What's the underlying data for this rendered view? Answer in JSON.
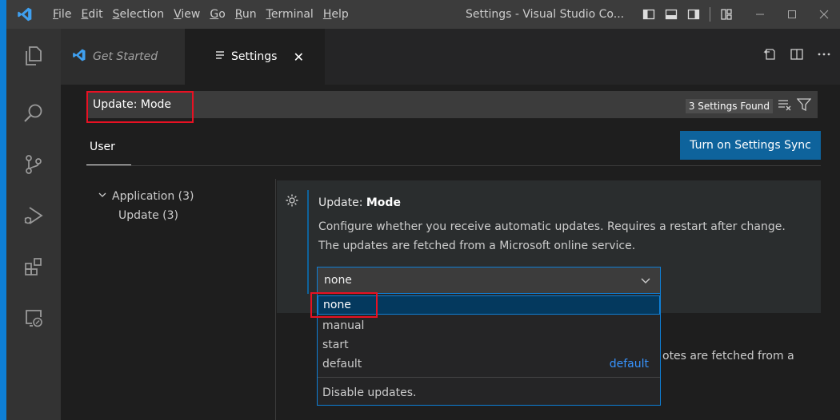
{
  "colors": {
    "accent": "#0e639c",
    "highlight": "#e81123",
    "focus": "#0e7fd6",
    "link": "#3794ff"
  },
  "titlebar": {
    "menu": [
      {
        "u": "F",
        "rest": "ile"
      },
      {
        "u": "E",
        "rest": "dit"
      },
      {
        "u": "S",
        "rest": "election"
      },
      {
        "u": "V",
        "rest": "iew"
      },
      {
        "u": "G",
        "rest": "o"
      },
      {
        "u": "R",
        "rest": "un"
      },
      {
        "u": "T",
        "rest": "erminal"
      },
      {
        "u": "H",
        "rest": "elp"
      }
    ],
    "window_title": "Settings - Visual Studio Co..."
  },
  "tabs": {
    "get_started": "Get Started",
    "settings": "Settings",
    "close_glyph": "✕"
  },
  "search": {
    "value": "Update: Mode",
    "count": "3 Settings Found"
  },
  "user_tab": "User",
  "sync_button": "Turn on Settings Sync",
  "toc": {
    "group": "Application (3)",
    "child": "Update (3)"
  },
  "setting": {
    "category": "Update: ",
    "name": "Mode",
    "description": "Configure whether you receive automatic updates. Requires a restart after change. The updates are fetched from a Microsoft online service.",
    "value": "none"
  },
  "dropdown": {
    "options": [
      "none",
      "manual",
      "start",
      "default"
    ],
    "default_badge": "default",
    "option_description": "Disable updates."
  },
  "behind_text": "otes are fetched from a"
}
